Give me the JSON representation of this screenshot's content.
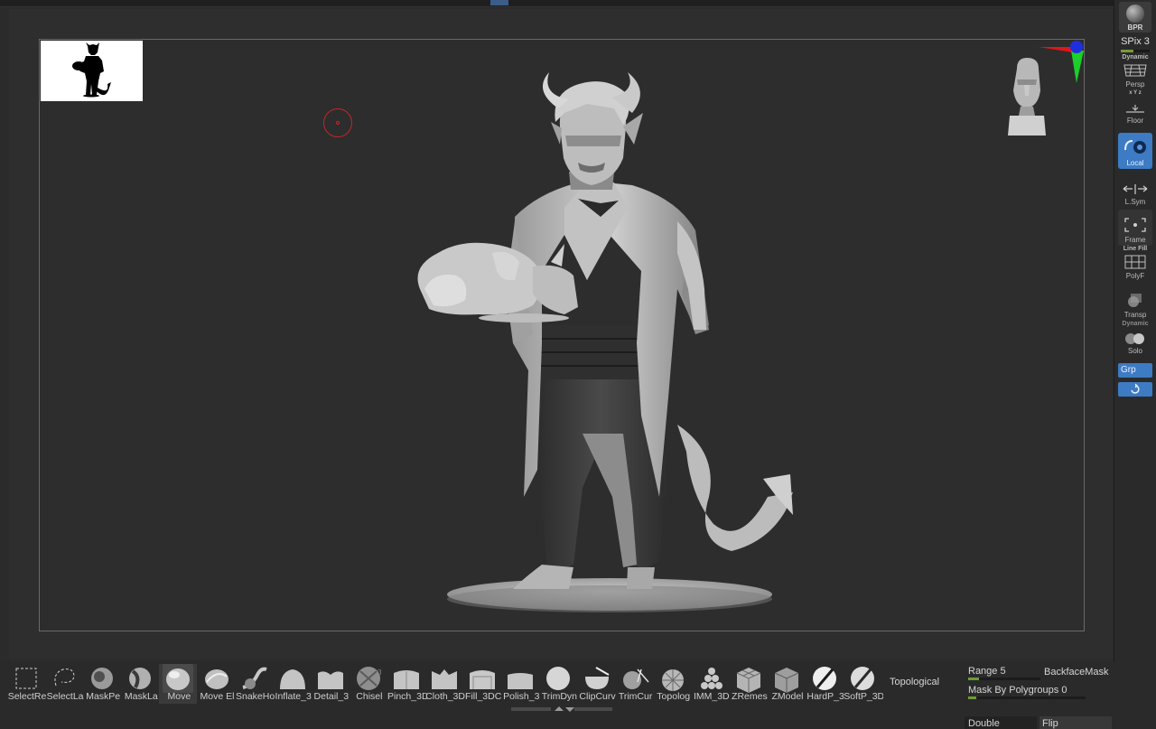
{
  "right_shelf": {
    "bpr_label": "BPR",
    "spix_label": "SPix 3",
    "persp": {
      "top": "Dynamic",
      "label": "Persp"
    },
    "floor": {
      "top": "x Y z",
      "label": "Floor"
    },
    "local": {
      "label": "Local"
    },
    "lsym": {
      "label": "L.Sym"
    },
    "frame": {
      "label": "Frame"
    },
    "polyf": {
      "top": "Line Fill",
      "label": "PolyF"
    },
    "transp": {
      "label": "Transp"
    },
    "solo": {
      "top": "Dynamic",
      "label": "Solo"
    },
    "grp_label": "Grp"
  },
  "brushes": [
    {
      "name": "SelectRe",
      "icon": "select-rect-icon",
      "selected": false
    },
    {
      "name": "SelectLa",
      "icon": "select-lasso-icon",
      "selected": false
    },
    {
      "name": "MaskPe",
      "icon": "mask-pen-icon",
      "selected": false
    },
    {
      "name": "MaskLa",
      "icon": "mask-lasso-icon",
      "selected": false
    },
    {
      "name": "Move",
      "icon": "move-brush-icon",
      "selected": true
    },
    {
      "name": "Move El",
      "icon": "move-elastic-icon",
      "selected": false
    },
    {
      "name": "SnakeHo",
      "icon": "snakehook-icon",
      "selected": false
    },
    {
      "name": "Inflate_3",
      "icon": "inflate-icon",
      "selected": false
    },
    {
      "name": "Detail_3",
      "icon": "detail-icon",
      "selected": false
    },
    {
      "name": "Chisel",
      "icon": "chisel-icon",
      "selected": false
    },
    {
      "name": "Pinch_3D",
      "icon": "pinch-icon",
      "selected": false
    },
    {
      "name": "Cloth_3D",
      "icon": "cloth-icon",
      "selected": false
    },
    {
      "name": "Fill_3DC",
      "icon": "fill-icon",
      "selected": false
    },
    {
      "name": "Polish_3",
      "icon": "polish-icon",
      "selected": false
    },
    {
      "name": "TrimDyn",
      "icon": "trimdynamic-icon",
      "selected": false
    },
    {
      "name": "ClipCurv",
      "icon": "clipcurve-icon",
      "selected": false
    },
    {
      "name": "TrimCur",
      "icon": "trimcurve-icon",
      "selected": false
    },
    {
      "name": "Topolog",
      "icon": "topology-icon",
      "selected": false
    },
    {
      "name": "IMM_3D",
      "icon": "imm-icon",
      "selected": false
    },
    {
      "name": "ZRemes",
      "icon": "zremesher-icon",
      "selected": false
    },
    {
      "name": "ZModel",
      "icon": "zmodeler-icon",
      "selected": false
    },
    {
      "name": "HardP_3",
      "icon": "hardpolish-icon",
      "selected": false
    },
    {
      "name": "SoftP_3D",
      "icon": "softpolish-icon",
      "selected": false
    }
  ],
  "tray": {
    "topological": "Topological",
    "range_label": "Range 5",
    "range_value": 5,
    "backface": "BackfaceMask",
    "maskpoly_label": "Mask By Polygroups 0",
    "maskpoly_value": 0,
    "double_label": "Double",
    "flip_label": "Flip"
  },
  "colors": {
    "accent": "#3d7bc4",
    "cursor_ring": "#c0282a",
    "gizmo_x": "#e0161a",
    "gizmo_y": "#1ccf2a",
    "gizmo_z": "#1f2fe0",
    "slider_fill": "#6e9b3a"
  }
}
